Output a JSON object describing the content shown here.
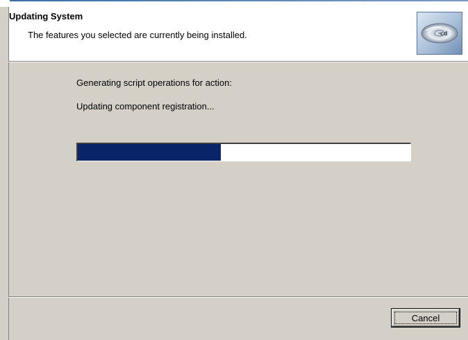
{
  "header": {
    "title": "Updating System",
    "subtitle": "The features you selected are currently being installed.",
    "icon": "installer-disc-icon"
  },
  "main": {
    "action_label": "Generating script operations for action:",
    "action_detail": "Updating component registration...",
    "progress_fraction": 0.43
  },
  "footer": {
    "cancel_label": "Cancel"
  },
  "colors": {
    "dialog_background": "#d4d0c8",
    "header_background": "#ffffff",
    "progress_fill": "#0a246a"
  }
}
